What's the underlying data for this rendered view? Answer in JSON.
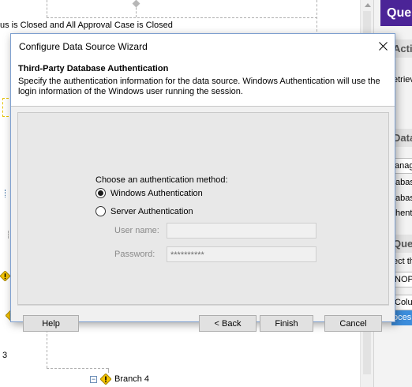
{
  "background": {
    "condition_text": "us is Closed and All Approval Case is Closed",
    "number_three": "3",
    "branch_label": "Branch 4",
    "right_panel": {
      "header": "Que",
      "section_activity": "Activ",
      "text_retrieve": "etriev",
      "section_data": "Data",
      "text_manage": "anag",
      "text_database_1": "tabas",
      "text_database_2": "tabas",
      "text_authent": "thent",
      "section_query": "Que",
      "text_select": "ect th",
      "input_value": "NOP",
      "text_column": "Colum",
      "selected_text": "oces"
    }
  },
  "dialog": {
    "title": "Configure Data Source Wizard",
    "header_title": "Third-Party Database Authentication",
    "header_description": "Specify the authentication information for the data source. Windows Authentication will use the login information of the Windows user running the session.",
    "choose_label": "Choose an authentication method:",
    "options": [
      {
        "label": "Windows Authentication",
        "selected": true
      },
      {
        "label": "Server Authentication",
        "selected": false
      }
    ],
    "username_label": "User name:",
    "username_value": "",
    "password_label": "Password:",
    "password_value": "**********",
    "buttons": {
      "help": "Help",
      "back": "< Back",
      "finish": "Finish",
      "cancel": "Cancel"
    }
  },
  "colors": {
    "accent_purple": "#4b2497",
    "selection_blue": "#3c8ddc",
    "warning_yellow": "#f5c400"
  }
}
